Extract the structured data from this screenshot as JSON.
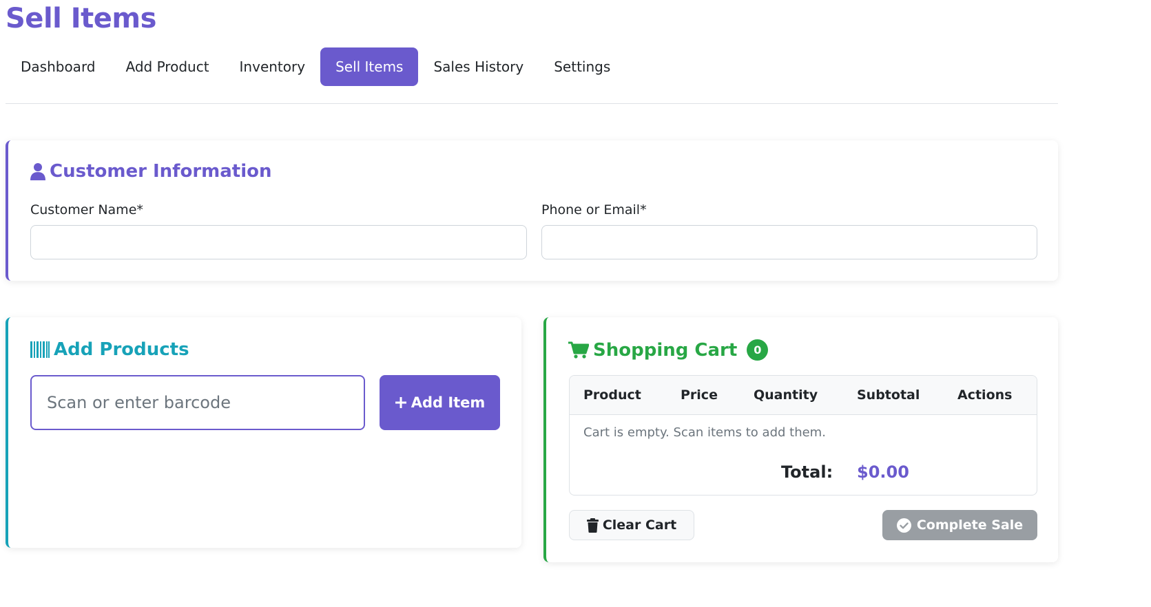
{
  "page": {
    "title": "Sell Items"
  },
  "nav": {
    "tabs": [
      {
        "label": "Dashboard"
      },
      {
        "label": "Add Product"
      },
      {
        "label": "Inventory"
      },
      {
        "label": "Sell Items",
        "active": true
      },
      {
        "label": "Sales History"
      },
      {
        "label": "Settings"
      }
    ]
  },
  "customer": {
    "title": "Customer Information",
    "icon": "user-icon",
    "name_label": "Customer Name*",
    "name_value": "",
    "contact_label": "Phone or Email*",
    "contact_value": ""
  },
  "add_products": {
    "title": "Add Products",
    "icon": "barcode-icon",
    "barcode_placeholder": "Scan or enter barcode",
    "add_button_label": "Add Item"
  },
  "cart": {
    "title": "Shopping Cart",
    "icon": "cart-icon",
    "item_count": "0",
    "columns": [
      "Product",
      "Price",
      "Quantity",
      "Subtotal",
      "Actions"
    ],
    "empty_message": "Cart is empty. Scan items to add them.",
    "total_label": "Total:",
    "total_value": "$0.00",
    "clear_label": "Clear Cart",
    "complete_label": "Complete Sale"
  },
  "colors": {
    "primary": "#6a5acd",
    "info": "#17a2b8",
    "success": "#28a745",
    "disabled": "#999ea3"
  }
}
